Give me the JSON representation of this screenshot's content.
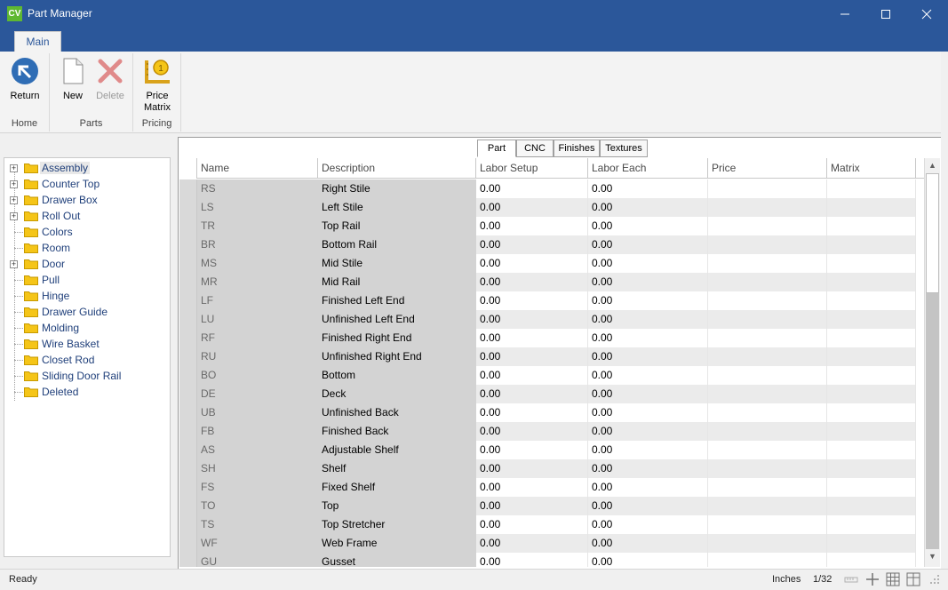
{
  "window": {
    "title": "Part Manager",
    "app_badge": "CV"
  },
  "ribbon": {
    "tab": "Main",
    "groups": [
      {
        "label": "Home",
        "buttons": [
          {
            "label": "Return",
            "icon": "return-arrow-icon"
          }
        ]
      },
      {
        "label": "Parts",
        "buttons": [
          {
            "label": "New",
            "icon": "new-document-icon"
          },
          {
            "label": "Delete",
            "icon": "delete-x-icon"
          }
        ]
      },
      {
        "label": "Pricing",
        "buttons": [
          {
            "label": "Price\nMatrix",
            "icon": "price-matrix-icon"
          }
        ]
      }
    ]
  },
  "tree": {
    "items": [
      {
        "label": "Assembly",
        "expandable": true,
        "selected": true
      },
      {
        "label": "Counter Top",
        "expandable": true
      },
      {
        "label": "Drawer Box",
        "expandable": true
      },
      {
        "label": "Roll Out",
        "expandable": true
      },
      {
        "label": "Colors",
        "expandable": false
      },
      {
        "label": "Room",
        "expandable": false
      },
      {
        "label": "Door",
        "expandable": true
      },
      {
        "label": "Pull",
        "expandable": false
      },
      {
        "label": "Hinge",
        "expandable": false
      },
      {
        "label": "Drawer Guide",
        "expandable": false
      },
      {
        "label": "Molding",
        "expandable": false
      },
      {
        "label": "Wire Basket",
        "expandable": false
      },
      {
        "label": "Closet Rod",
        "expandable": false
      },
      {
        "label": "Sliding Door Rail",
        "expandable": false
      },
      {
        "label": "Deleted",
        "expandable": false
      }
    ]
  },
  "subtabs": [
    "Part",
    "CNC",
    "Finishes",
    "Textures"
  ],
  "grid": {
    "columns": [
      "Name",
      "Description",
      "Labor Setup",
      "Labor Each",
      "Price",
      "Matrix"
    ],
    "rows": [
      [
        "RS",
        "Right Stile",
        "0.00",
        "0.00",
        "",
        ""
      ],
      [
        "LS",
        "Left Stile",
        "0.00",
        "0.00",
        "",
        ""
      ],
      [
        "TR",
        "Top Rail",
        "0.00",
        "0.00",
        "",
        ""
      ],
      [
        "BR",
        "Bottom Rail",
        "0.00",
        "0.00",
        "",
        ""
      ],
      [
        "MS",
        "Mid Stile",
        "0.00",
        "0.00",
        "",
        ""
      ],
      [
        "MR",
        "Mid Rail",
        "0.00",
        "0.00",
        "",
        ""
      ],
      [
        "LF",
        "Finished Left End",
        "0.00",
        "0.00",
        "",
        ""
      ],
      [
        "LU",
        "Unfinished Left End",
        "0.00",
        "0.00",
        "",
        ""
      ],
      [
        "RF",
        "Finished Right End",
        "0.00",
        "0.00",
        "",
        ""
      ],
      [
        "RU",
        "Unfinished Right End",
        "0.00",
        "0.00",
        "",
        ""
      ],
      [
        "BO",
        "Bottom",
        "0.00",
        "0.00",
        "",
        ""
      ],
      [
        "DE",
        "Deck",
        "0.00",
        "0.00",
        "",
        ""
      ],
      [
        "UB",
        "Unfinished Back",
        "0.00",
        "0.00",
        "",
        ""
      ],
      [
        "FB",
        "Finished Back",
        "0.00",
        "0.00",
        "",
        ""
      ],
      [
        "AS",
        "Adjustable Shelf",
        "0.00",
        "0.00",
        "",
        ""
      ],
      [
        "SH",
        "Shelf",
        "0.00",
        "0.00",
        "",
        ""
      ],
      [
        "FS",
        "Fixed Shelf",
        "0.00",
        "0.00",
        "",
        ""
      ],
      [
        "TO",
        "Top",
        "0.00",
        "0.00",
        "",
        ""
      ],
      [
        "TS",
        "Top Stretcher",
        "0.00",
        "0.00",
        "",
        ""
      ],
      [
        "WF",
        "Web Frame",
        "0.00",
        "0.00",
        "",
        ""
      ],
      [
        "GU",
        "Gusset",
        "0.00",
        "0.00",
        "",
        ""
      ]
    ]
  },
  "status": {
    "text": "Ready",
    "units": "Inches",
    "fraction": "1/32"
  },
  "colors": {
    "titlebar": "#2b579a",
    "accent": "#2b579a",
    "folder": "#f5c518",
    "delete_red": "#e06666"
  }
}
